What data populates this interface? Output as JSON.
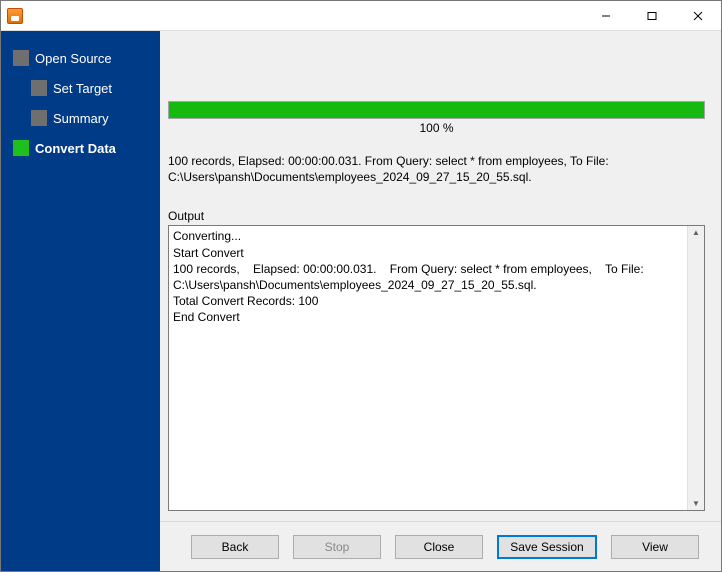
{
  "titlebar": {
    "title": ""
  },
  "sidebar": {
    "items": [
      {
        "label": "Open Source",
        "level": 0,
        "active": false
      },
      {
        "label": "Set Target",
        "level": 1,
        "active": false
      },
      {
        "label": "Summary",
        "level": 1,
        "active": false
      },
      {
        "label": "Convert Data",
        "level": 0,
        "active": true
      }
    ]
  },
  "progress": {
    "percent_text": "100 %"
  },
  "summary_text": "100 records,    Elapsed: 00:00:00.031.    From Query: select * from employees,    To File: C:\\Users\\pansh\\Documents\\employees_2024_09_27_15_20_55.sql.",
  "output": {
    "label": "Output",
    "text": "Converting...\nStart Convert\n100 records,    Elapsed: 00:00:00.031.    From Query: select * from employees,    To File: C:\\Users\\pansh\\Documents\\employees_2024_09_27_15_20_55.sql.\nTotal Convert Records: 100\nEnd Convert"
  },
  "buttons": {
    "back": "Back",
    "stop": "Stop",
    "close": "Close",
    "save_session": "Save Session",
    "view": "View"
  }
}
